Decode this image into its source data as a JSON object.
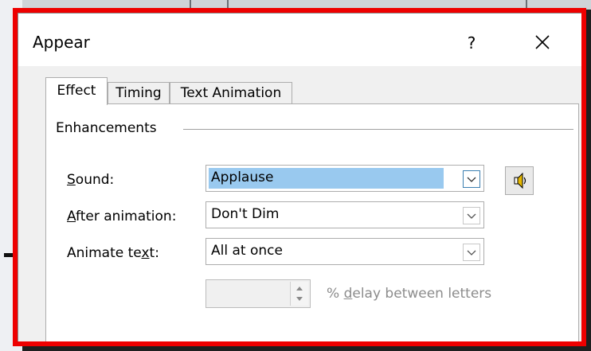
{
  "dialog": {
    "title": "Appear",
    "help_label": "?",
    "close_icon": "close-icon"
  },
  "tabs": [
    {
      "label": "Effect",
      "active": true
    },
    {
      "label": "Timing",
      "active": false
    },
    {
      "label": "Text Animation",
      "active": false
    }
  ],
  "enhancements": {
    "group_label": "Enhancements",
    "sound": {
      "label_pre": "",
      "label_accel": "S",
      "label_post": "ound:",
      "value": "Applause",
      "icon": "speaker-icon"
    },
    "after_animation": {
      "label_pre": "",
      "label_accel": "A",
      "label_post": "fter animation:",
      "value": "Don't Dim"
    },
    "animate_text": {
      "label_pre": "Animate te",
      "label_accel": "x",
      "label_post": "t:",
      "value": "All at once"
    },
    "delay": {
      "value": "",
      "label_pre": "% ",
      "label_accel": "d",
      "label_post": "elay between letters",
      "enabled": false
    }
  },
  "colors": {
    "highlight_frame": "#ee0000",
    "selection": "#99c9ef",
    "disabled_text": "#8c8c8c"
  }
}
